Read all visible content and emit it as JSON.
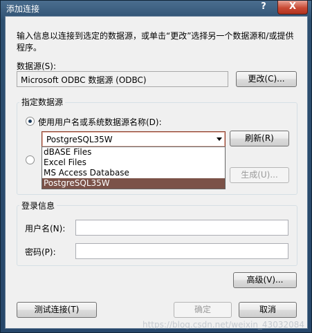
{
  "window": {
    "title": "添加连接",
    "help_label": "?",
    "close_label": "X"
  },
  "description": "输入信息以连接到选定的数据源，或单击“更改”选择另一个数据源和/或提供程序。",
  "datasource": {
    "label": "数据源(S):",
    "value": "Microsoft ODBC 数据源 (ODBC)",
    "change_button": "更改(C)..."
  },
  "specify_group": {
    "title": "指定数据源",
    "use_dsn_radio": "使用用户名或系统数据源名称(D):",
    "use_dsn_checked": true,
    "dsn_combo_value": "PostgreSQL35W",
    "refresh_button": "刷新(R)",
    "generate_button": "生成(U)...",
    "dropdown_options": [
      "dBASE Files",
      "Excel Files",
      "MS Access Database",
      "PostgreSQL35W"
    ],
    "dropdown_selected": "PostgreSQL35W"
  },
  "login_group": {
    "title": "登录信息",
    "username_label": "用户名(N):",
    "username_value": "",
    "password_label": "密码(P):",
    "password_value": ""
  },
  "buttons": {
    "advanced": "高级(V)...",
    "test": "测试连接(T)",
    "ok": "确定",
    "cancel": "取消"
  },
  "watermark": "https://blog.csdn.net/weixin_43032084"
}
